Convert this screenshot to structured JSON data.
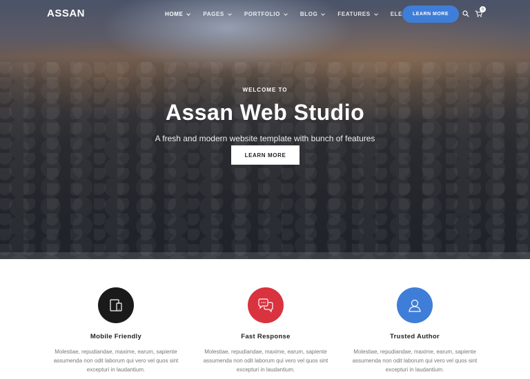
{
  "header": {
    "logo": "ASSAN",
    "menu": [
      {
        "label": "HOME"
      },
      {
        "label": "PAGES"
      },
      {
        "label": "PORTFOLIO"
      },
      {
        "label": "BLOG"
      },
      {
        "label": "FEATURES"
      },
      {
        "label": "ELEMENTS"
      }
    ],
    "cta_label": "LEARN MORE",
    "search_icon": "search-icon",
    "cart_icon": "cart-icon",
    "cart_count": "0"
  },
  "hero": {
    "eyebrow": "WELCOME TO",
    "title": "Assan Web Studio",
    "subtitle": "A fresh and modern website template with bunch of features",
    "button_label": "LEARN MORE"
  },
  "features": [
    {
      "icon": "mobile-icon",
      "color": "#1a1a1a",
      "title": "Mobile Friendly",
      "text": "Molestiae, repudiandae, maxime, earum, sapiente assumenda non odit laborum qui vero vel quos sint excepturi in laudantium."
    },
    {
      "icon": "chat-icon",
      "color": "#d9333f",
      "title": "Fast Response",
      "text": "Molestiae, repudiandae, maxime, earum, sapiente assumenda non odit laborum qui vero vel quos sint excepturi in laudantium."
    },
    {
      "icon": "user-icon",
      "color": "#3f7ed8",
      "title": "Trusted Author",
      "text": "Molestiae, repudiandae, maxime, earum, sapiente assumenda non odit laborum qui vero vel quos sint excepturi in laudantium."
    }
  ],
  "colors": {
    "accent": "#3f7ed8",
    "red": "#d9333f",
    "dark": "#1a1a1a"
  }
}
